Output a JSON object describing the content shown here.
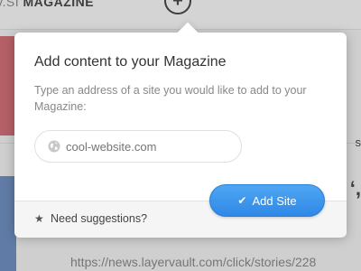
{
  "background": {
    "logo_prefix": "v.SI",
    "logo_name": "MAGAZINE",
    "plus_glyph": "+",
    "fragment_s": "s",
    "fragment_quote": "‘,",
    "link_text": "https://news.layervault.com/click/stories/228"
  },
  "popover": {
    "title": "Add content to your Magazine",
    "description": "Type an address of a site you would like to add to your Magazine:",
    "input": {
      "value": "",
      "placeholder": "cool-website.com",
      "icon": "globe-icon"
    },
    "suggestions_label": "Need suggestions?",
    "suggestions_icon": "star-icon",
    "add_button_label": "Add Site",
    "add_button_icon": "check-icon",
    "accent_color": "#3b95ec"
  }
}
